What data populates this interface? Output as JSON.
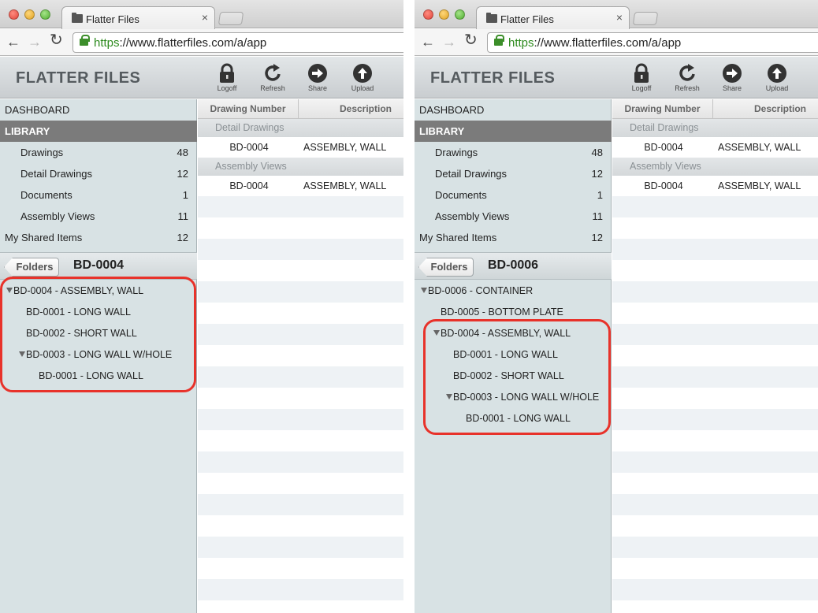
{
  "browser": {
    "tab_title": "Flatter Files",
    "tab_close": "×",
    "url_protocol": "https",
    "url_rest": "://www.flatterfiles.com/a/app",
    "nav_back": "←",
    "nav_forward": "→",
    "nav_reload": "↻"
  },
  "app": {
    "brand": "FLATTER FILES",
    "toolbar": {
      "logoff": "Logoff",
      "refresh": "Refresh",
      "share": "Share",
      "upload": "Upload"
    }
  },
  "sidebar": {
    "dashboard": "DASHBOARD",
    "library": "LIBRARY",
    "items": [
      {
        "label": "Drawings",
        "count": "48"
      },
      {
        "label": "Detail Drawings",
        "count": "12"
      },
      {
        "label": "Documents",
        "count": "1"
      },
      {
        "label": "Assembly Views",
        "count": "11"
      }
    ],
    "shared": {
      "label": "My Shared Items",
      "count": "12"
    },
    "folders_button": "Folders"
  },
  "table": {
    "col_drawing_number": "Drawing Number",
    "col_description": "Description",
    "groups": [
      {
        "name": "Detail Drawings",
        "rows": [
          {
            "number": "BD-0004",
            "description": "ASSEMBLY, WALL"
          }
        ]
      },
      {
        "name": "Assembly Views",
        "rows": [
          {
            "number": "BD-0004",
            "description": "ASSEMBLY, WALL"
          }
        ]
      }
    ]
  },
  "panels": [
    {
      "folder_title": "BD-0004",
      "tree": [
        {
          "label": "BD-0004 - ASSEMBLY, WALL",
          "depth": 0,
          "expanded": true
        },
        {
          "label": "BD-0001 - LONG WALL",
          "depth": 1,
          "expanded": false
        },
        {
          "label": "BD-0002 - SHORT WALL",
          "depth": 1,
          "expanded": false
        },
        {
          "label": "BD-0003 - LONG WALL W/HOLE",
          "depth": 1,
          "expanded": true
        },
        {
          "label": "BD-0001 - LONG WALL",
          "depth": 2,
          "expanded": false
        }
      ]
    },
    {
      "folder_title": "BD-0006",
      "tree": [
        {
          "label": "BD-0006 - CONTAINER",
          "depth": 0,
          "expanded": true
        },
        {
          "label": "BD-0005 - BOTTOM PLATE",
          "depth": 1,
          "expanded": false
        },
        {
          "label": "BD-0004 - ASSEMBLY, WALL",
          "depth": 1,
          "expanded": true
        },
        {
          "label": "BD-0001 - LONG WALL",
          "depth": 2,
          "expanded": false
        },
        {
          "label": "BD-0002 - SHORT WALL",
          "depth": 2,
          "expanded": false
        },
        {
          "label": "BD-0003 - LONG WALL W/HOLE",
          "depth": 2,
          "expanded": true
        },
        {
          "label": "BD-0001 - LONG WALL",
          "depth": 3,
          "expanded": false
        }
      ]
    }
  ],
  "colors": {
    "highlight": "#e8322a",
    "library_bar": "#7b7b7b",
    "sidebar_bg": "#d8e2e4",
    "url_protocol": "#2c8a1c"
  }
}
